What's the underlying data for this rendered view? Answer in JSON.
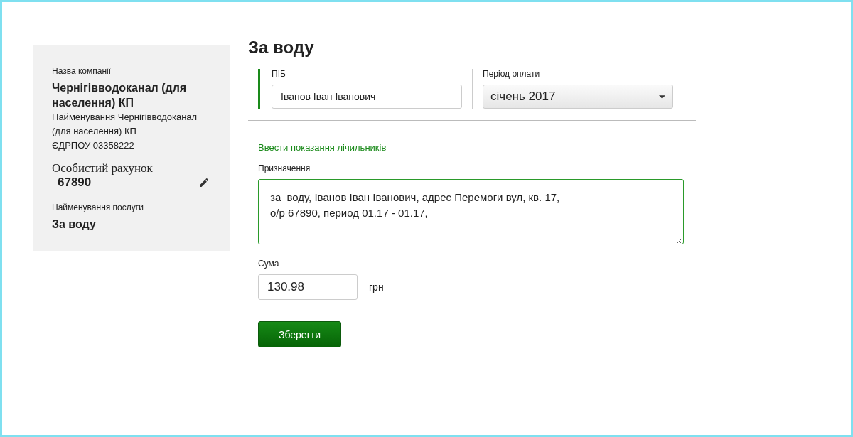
{
  "company": {
    "label": "Назва компанії",
    "name": "Чернігівводоканал (для населення) КП",
    "full_name": "Найменування Чернігівводоканал (для населення) КП",
    "edrpou": "ЄДРПОУ 03358222",
    "account_label": "Особистий рахунок",
    "account": "67890",
    "service_label": "Найменування послуги",
    "service": "За воду"
  },
  "title": "За воду",
  "fio": {
    "label": "ПІБ",
    "value": "Іванов Іван Іванович"
  },
  "period": {
    "label": "Період оплати",
    "value": "січень 2017"
  },
  "meter_link": "Ввести показання лічильників",
  "purpose": {
    "label": "Призначення",
    "value": "за  воду, Іванов Іван Іванович, адрес Перемоги вул, кв. 17,    о/р 67890, период 01.17 - 01.17,"
  },
  "amount": {
    "label": "Сума",
    "value": "130.98",
    "currency": "грн"
  },
  "save_button": "Зберегти"
}
